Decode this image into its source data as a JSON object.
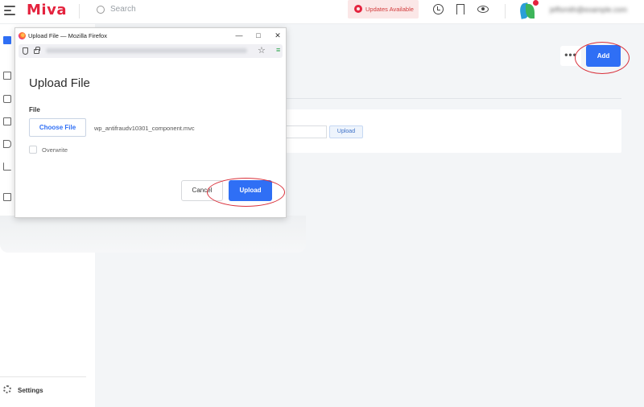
{
  "app": {
    "logo": "Miva",
    "search_placeholder": "Search",
    "updates_label": "Updates Available",
    "user_email": "jeffsmith@example.com"
  },
  "sidebar": {
    "settings_label": "Settings"
  },
  "main": {
    "more_label": "•••",
    "add_label": "Add",
    "bg_upload_label": "Upload"
  },
  "popup_window": {
    "title": "Upload File — Mozilla Firefox",
    "minimize": "—",
    "maximize": "□",
    "close": "✕"
  },
  "dialog": {
    "title": "Upload File",
    "file_label": "File",
    "choose_file_label": "Choose File",
    "selected_file": "wp_antifraudv10301_component.mvc",
    "overwrite_label": "Overwrite",
    "overwrite_checked": false,
    "cancel_label": "Cancel",
    "upload_label": "Upload"
  },
  "colors": {
    "accent": "#2f6ff5",
    "brand": "#e4233e",
    "annotation": "#d9303a"
  }
}
